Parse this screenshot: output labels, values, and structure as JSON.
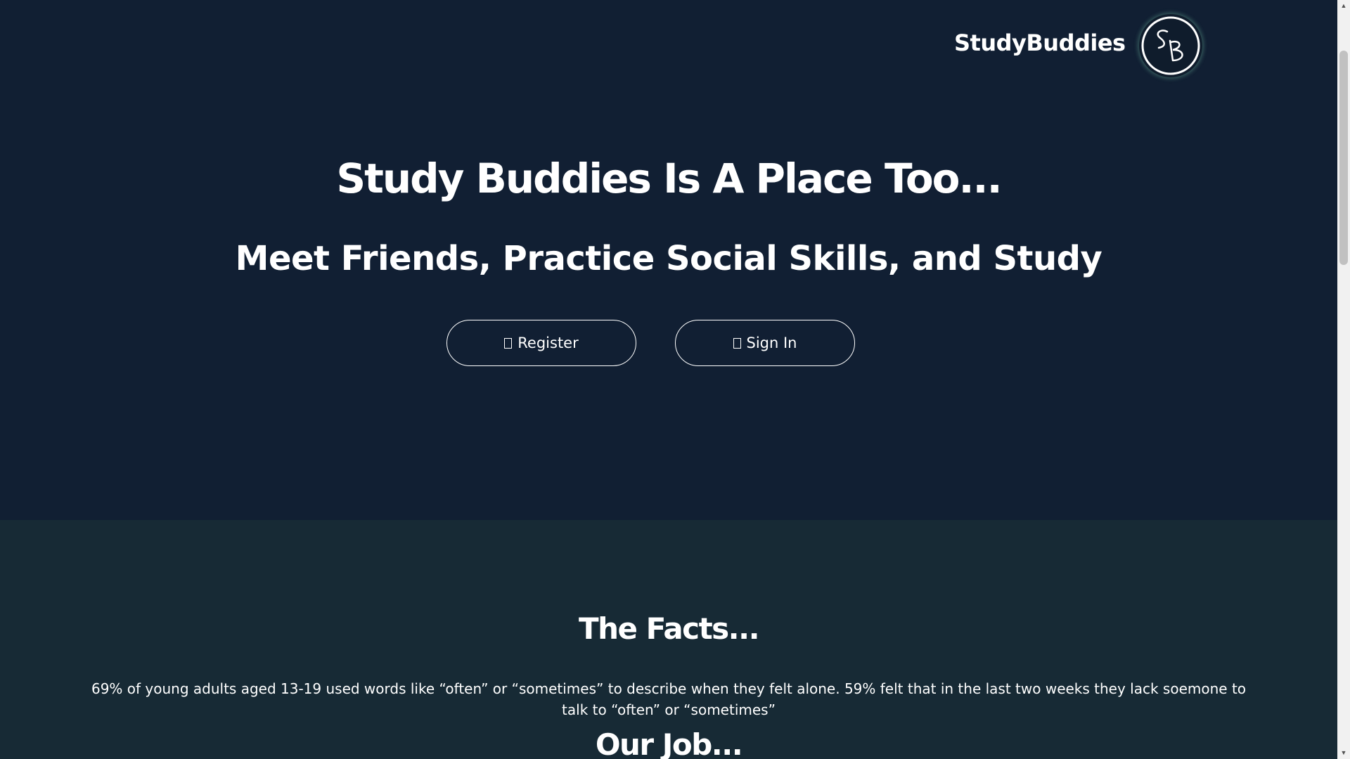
{
  "header": {
    "brand": "StudyBuddies",
    "logo_text": "SB"
  },
  "hero": {
    "headline": "Study Buddies Is A Place Too...",
    "subheadline": "Meet Friends, Practice Social Skills, and Study",
    "register_label": "Register",
    "signin_label": "Sign In"
  },
  "facts": {
    "title": "The Facts...",
    "text": "69% of young adults aged 13-19 used words like “often” or “sometimes” to describe when they felt alone. 59% felt that in the last two weeks they lack soemone to talk to “often” or “sometimes”"
  },
  "job": {
    "title": "Our Job..."
  },
  "scrollbar": {
    "up_arrow": "▲",
    "down_arrow": "▼"
  },
  "colors": {
    "hero_bg": "#111f33",
    "facts_bg": "#172a35",
    "text": "#ffffff",
    "logo_glow": "#78c8aa"
  }
}
